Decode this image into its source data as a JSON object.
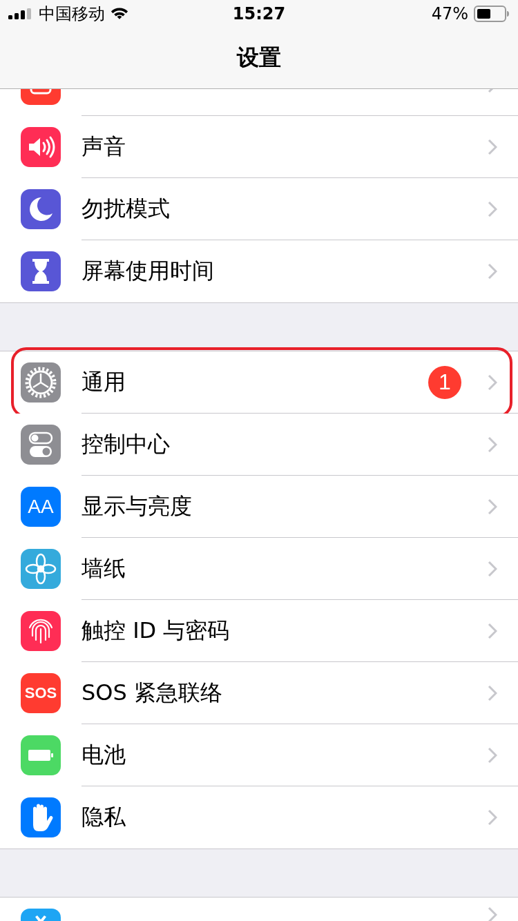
{
  "status_bar": {
    "carrier": "中国移动",
    "time": "15:27",
    "battery": "47%"
  },
  "nav": {
    "title": "设置"
  },
  "groups": [
    {
      "items": [
        {
          "kind": "notifications",
          "color": "#ff3b30"
        },
        {
          "label": "声音",
          "kind": "sound",
          "color": "#ff2d55"
        },
        {
          "label": "勿扰模式",
          "kind": "moon",
          "color": "#5856d6"
        },
        {
          "label": "屏幕使用时间",
          "kind": "hourglass",
          "color": "#5856d6"
        }
      ]
    },
    {
      "items": [
        {
          "label": "通用",
          "kind": "gear",
          "color": "#8e8e93",
          "badge": "1",
          "annotated": true
        },
        {
          "label": "控制中心",
          "kind": "toggles",
          "color": "#8e8e93"
        },
        {
          "label": "显示与亮度",
          "kind": "text",
          "icon_text": "AA",
          "color": "#007aff"
        },
        {
          "label": "墙纸",
          "kind": "flower",
          "color": "#34aadc"
        },
        {
          "label": "触控 ID 与密码",
          "kind": "fingerprint",
          "color": "#ff2d55"
        },
        {
          "label": "SOS 紧急联络",
          "kind": "text",
          "icon_text": "SOS",
          "color": "#ff3b30"
        },
        {
          "label": "电池",
          "kind": "battery",
          "color": "#4cd964"
        },
        {
          "label": "隐私",
          "kind": "hand",
          "color": "#007aff"
        }
      ]
    },
    {
      "items": [
        {
          "kind": "store",
          "color": "#1ea5f4"
        }
      ]
    }
  ]
}
